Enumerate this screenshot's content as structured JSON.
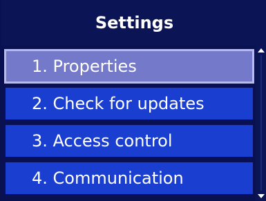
{
  "title": "Settings",
  "menu": {
    "items": [
      {
        "label": "1. Properties",
        "selected": true
      },
      {
        "label": "2. Check for updates",
        "selected": false
      },
      {
        "label": "3. Access control",
        "selected": false
      },
      {
        "label": "4. Communication",
        "selected": false
      }
    ]
  },
  "colors": {
    "background": "#0a1150",
    "item": "#1a3fd0",
    "item_selected": "#7479c9",
    "text": "#ffffff"
  }
}
